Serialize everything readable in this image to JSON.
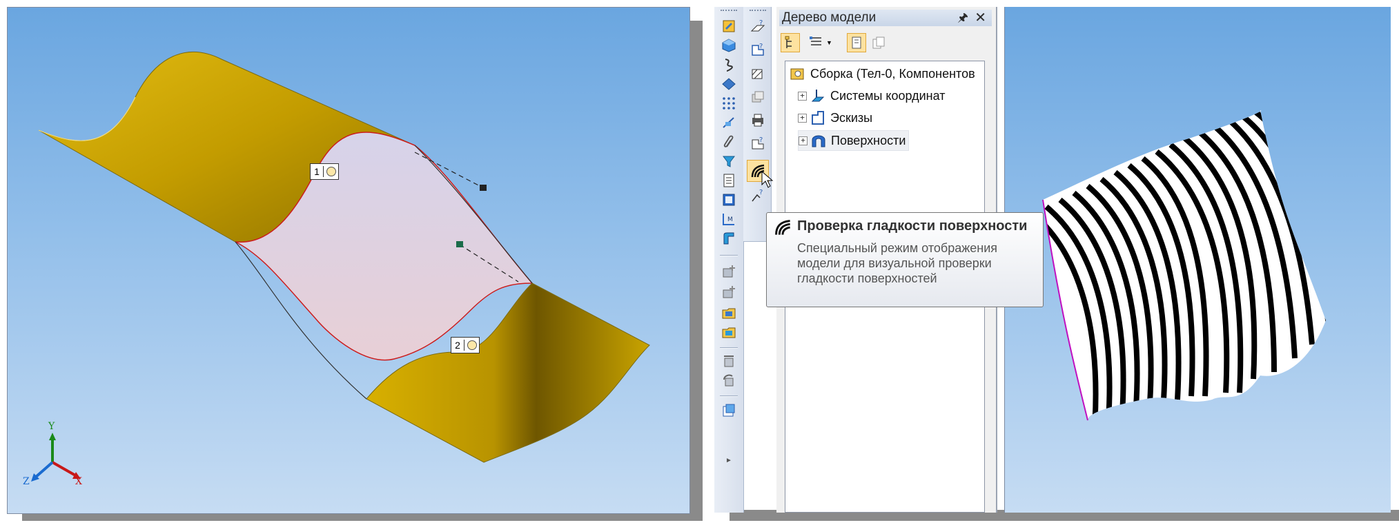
{
  "left_view": {
    "label_1": "1",
    "label_2": "2",
    "axis_x": "X",
    "axis_y": "Y",
    "axis_z": "Z"
  },
  "model_tree": {
    "title": "Дерево модели",
    "pin_icon": "pin-icon",
    "close_icon": "close-icon",
    "nodes": [
      {
        "label": "Сборка (Тел-0, Компонентов",
        "icon": "assembly-icon"
      },
      {
        "label": "Системы координат",
        "icon": "coordinate-systems-icon",
        "expander": "+"
      },
      {
        "label": "Эскизы",
        "icon": "sketches-icon",
        "expander": "+"
      },
      {
        "label": "Поверхности",
        "icon": "surfaces-icon",
        "expander": "+"
      }
    ]
  },
  "tooltip": {
    "title": "Проверка гладкости поверхности",
    "description": "Специальный режим отображения модели для визуальной проверки гладкости поверхностей",
    "icon": "zebra-stripes-icon"
  },
  "colors": {
    "surface_yellow": "#c9a400",
    "patch_lilac": "#dcd2e6",
    "highlight": "#fde2a0",
    "edge_red": "#d01010"
  }
}
